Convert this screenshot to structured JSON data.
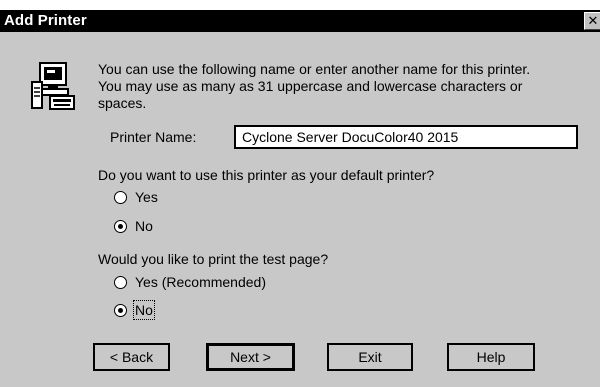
{
  "window": {
    "title": "Add Printer",
    "close_glyph": "✕"
  },
  "description": {
    "line1": "You can use the following name or enter another name for this printer.",
    "line2": "You may use as many as 31 uppercase and lowercase characters or",
    "line3": "spaces."
  },
  "printer_name": {
    "label": "Printer Name:",
    "value": "Cyclone Server DocuColor40 2015"
  },
  "default_printer": {
    "question": "Do you want to use this printer as your default printer?",
    "options": [
      {
        "label": "Yes",
        "selected": false
      },
      {
        "label": "No",
        "selected": true
      }
    ]
  },
  "test_page": {
    "question": "Would you like to print the test page?",
    "options": [
      {
        "label": "Yes (Recommended)",
        "selected": false
      },
      {
        "label": "No",
        "selected": true
      }
    ]
  },
  "buttons": {
    "back": "< Back",
    "next": "Next >",
    "exit": "Exit",
    "help": "Help"
  },
  "icons": {
    "app": "printer-computer-icon"
  }
}
